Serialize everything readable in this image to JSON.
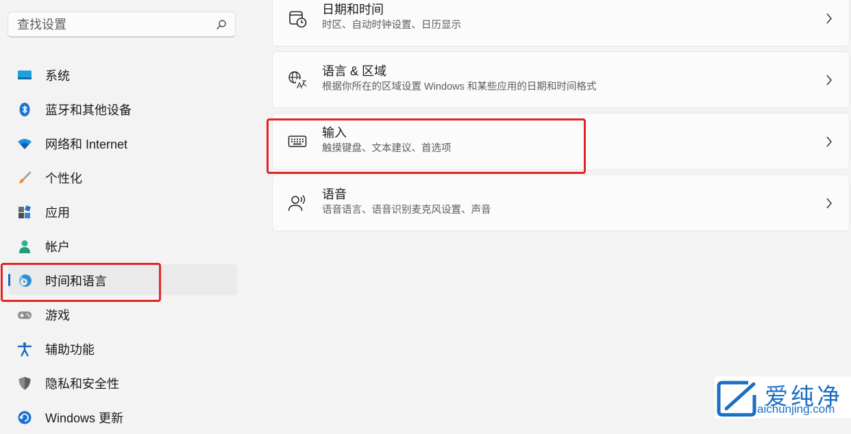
{
  "search": {
    "placeholder": "查找设置"
  },
  "sidebar": {
    "items": [
      {
        "label": "系统",
        "icon": "system-icon"
      },
      {
        "label": "蓝牙和其他设备",
        "icon": "bluetooth-icon"
      },
      {
        "label": "网络和 Internet",
        "icon": "wifi-icon"
      },
      {
        "label": "个性化",
        "icon": "brush-icon"
      },
      {
        "label": "应用",
        "icon": "apps-icon"
      },
      {
        "label": "帐户",
        "icon": "account-icon"
      },
      {
        "label": "时间和语言",
        "icon": "time-language-icon",
        "selected": true
      },
      {
        "label": "游戏",
        "icon": "gamepad-icon"
      },
      {
        "label": "辅助功能",
        "icon": "accessibility-icon"
      },
      {
        "label": "隐私和安全性",
        "icon": "shield-icon"
      },
      {
        "label": "Windows 更新",
        "icon": "windows-update-icon"
      }
    ]
  },
  "main": {
    "cards": [
      {
        "title": "日期和时间",
        "subtitle": "时区、自动时钟设置、日历显示",
        "icon": "calendar-clock-icon"
      },
      {
        "title": "语言 & 区域",
        "subtitle": "根据你所在的区域设置 Windows 和某些应用的日期和时间格式",
        "icon": "language-region-icon"
      },
      {
        "title": "输入",
        "subtitle": "触摸键盘、文本建议、首选项",
        "icon": "keyboard-icon"
      },
      {
        "title": "语音",
        "subtitle": "语音语言、语音识别麦克风设置、声音",
        "icon": "speech-icon"
      }
    ]
  },
  "colors": {
    "accent": "#0f6cbd",
    "highlight": "#e02525",
    "watermark": "#1a6fc2"
  },
  "watermark": {
    "name": "爱纯净",
    "url": "aichunjing.com"
  }
}
